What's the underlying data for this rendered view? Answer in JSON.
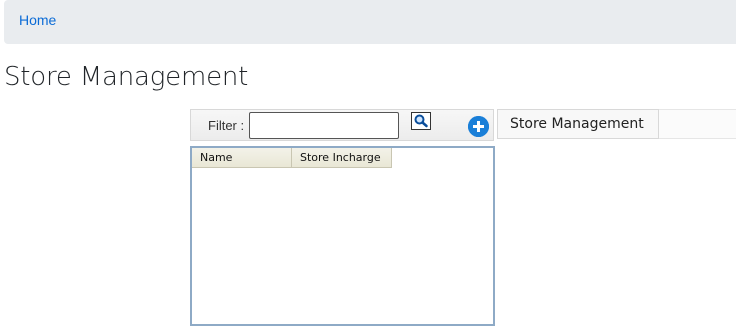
{
  "breadcrumb": {
    "home_label": "Home"
  },
  "page": {
    "title": "Store Management"
  },
  "filter": {
    "label": "Filter :",
    "value": "",
    "placeholder": ""
  },
  "toolbar": {
    "search_icon": "search-icon",
    "add_icon": "plus-circle-icon"
  },
  "tabs": [
    {
      "label": "Store Management"
    }
  ],
  "grid": {
    "columns": [
      "Name",
      "Store Incharge"
    ],
    "rows": []
  },
  "colors": {
    "link": "#0b6bd6",
    "breadcrumb_bg": "#e9ecef",
    "add_button": "#1a7fd8",
    "grid_border": "#8eaac6",
    "header_bg": "#ece9d8"
  }
}
